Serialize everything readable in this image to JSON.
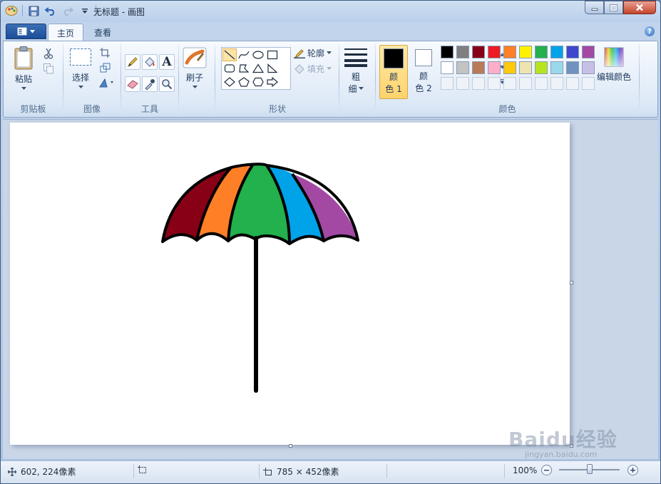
{
  "window": {
    "title": "无标题 - 画图"
  },
  "tabs": [
    {
      "label": "主页"
    },
    {
      "label": "查看"
    }
  ],
  "help_label": "?",
  "clipboard": {
    "paste_label": "粘贴",
    "group_label": "剪贴板"
  },
  "image": {
    "select_label": "选择",
    "group_label": "图像"
  },
  "tools": {
    "group_label": "工具",
    "text_tool_glyph": "A"
  },
  "brushes": {
    "label": "刷子"
  },
  "shapes": {
    "group_label": "形状",
    "outline_label": "轮廓",
    "fill_label": "填充"
  },
  "size": {
    "label_line1": "粗",
    "label_line2": "细"
  },
  "colors": {
    "group_label": "颜色",
    "color1_label_line1": "颜",
    "color1_label_line2": "色 1",
    "color2_label_line1": "颜",
    "color2_label_line2": "色 2",
    "color1_value": "#000000",
    "color2_value": "#ffffff",
    "edit_colors_label": "编辑颜色",
    "palette_row1": [
      "#000000",
      "#7f7f7f",
      "#880015",
      "#ed1c24",
      "#ff7f27",
      "#fff200",
      "#22b14c",
      "#00a2e8",
      "#3f48cc",
      "#a349a4"
    ],
    "palette_row2": [
      "#ffffff",
      "#c3c3c3",
      "#b97a57",
      "#ffaec9",
      "#ffc90e",
      "#efe4b0",
      "#b5e61d",
      "#99d9ea",
      "#7092be",
      "#c8bfe7"
    ]
  },
  "drawing": {
    "umbrella_colors": [
      "#880015",
      "#ff7f27",
      "#22b14c",
      "#00a2e8",
      "#a349a4"
    ],
    "outline_color": "#000000"
  },
  "status": {
    "cursor_pos": "602, 224像素",
    "canvas_size": "785 × 452像素",
    "zoom": "100%"
  },
  "watermark": {
    "text": "Baidu经验",
    "sub": "jingyan.baidu.com"
  }
}
